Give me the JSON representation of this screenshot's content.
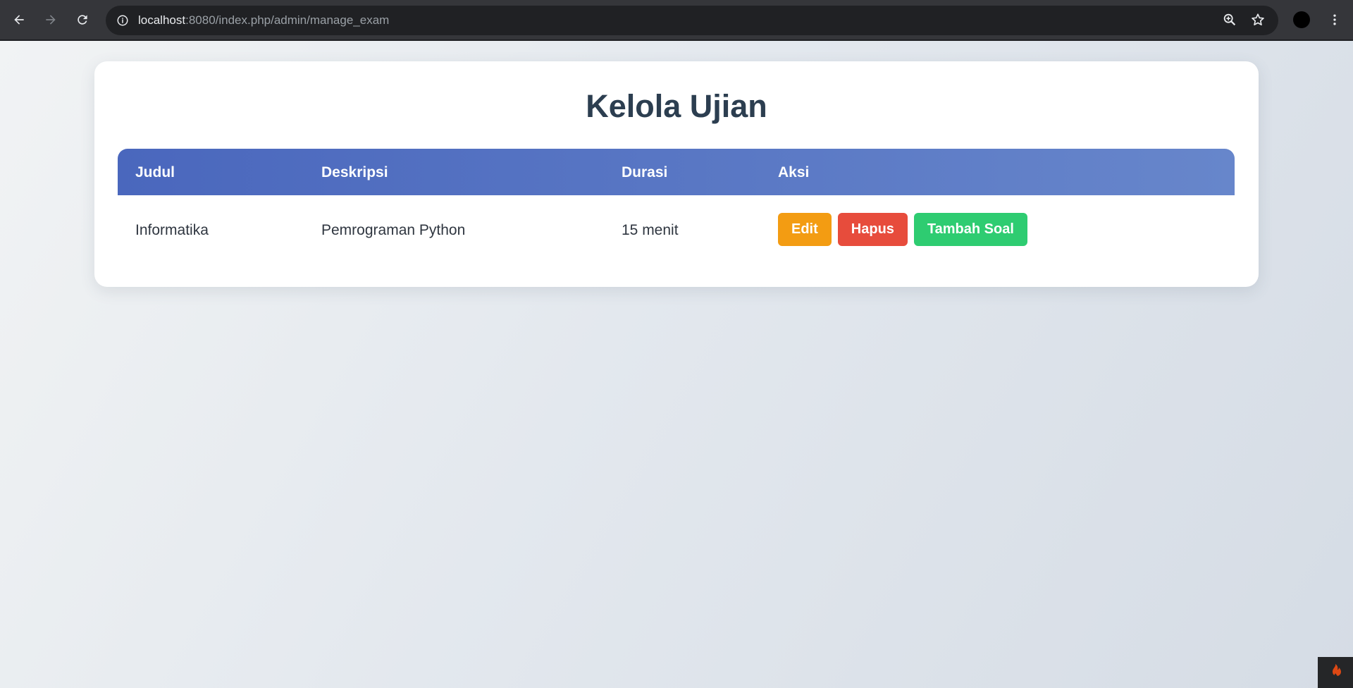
{
  "browser": {
    "url_host": "localhost",
    "url_path": ":8080/index.php/admin/manage_exam",
    "icons": {
      "back": "arrow-left-icon",
      "forward": "arrow-right-icon",
      "reload": "reload-icon",
      "site_info": "info-icon",
      "zoom": "zoom-icon",
      "bookmark": "star-icon",
      "menu": "kebab-menu-icon"
    }
  },
  "page": {
    "title": "Kelola Ujian",
    "table": {
      "headers": [
        "Judul",
        "Deskripsi",
        "Durasi",
        "Aksi"
      ],
      "rows": [
        {
          "judul": "Informatika",
          "deskripsi": "Pemrograman Python",
          "durasi": "15 menit",
          "actions": {
            "edit": "Edit",
            "hapus": "Hapus",
            "tambah_soal": "Tambah Soal"
          }
        }
      ]
    },
    "colors": {
      "title": "#2c3e50",
      "header_gradient_start": "#4a67bd",
      "header_gradient_end": "#6786cb",
      "edit": "#f39c12",
      "hapus": "#e74c3c",
      "tambah_soal": "#2ecc71"
    }
  },
  "debug_toolbar": {
    "icon": "flame-icon"
  }
}
